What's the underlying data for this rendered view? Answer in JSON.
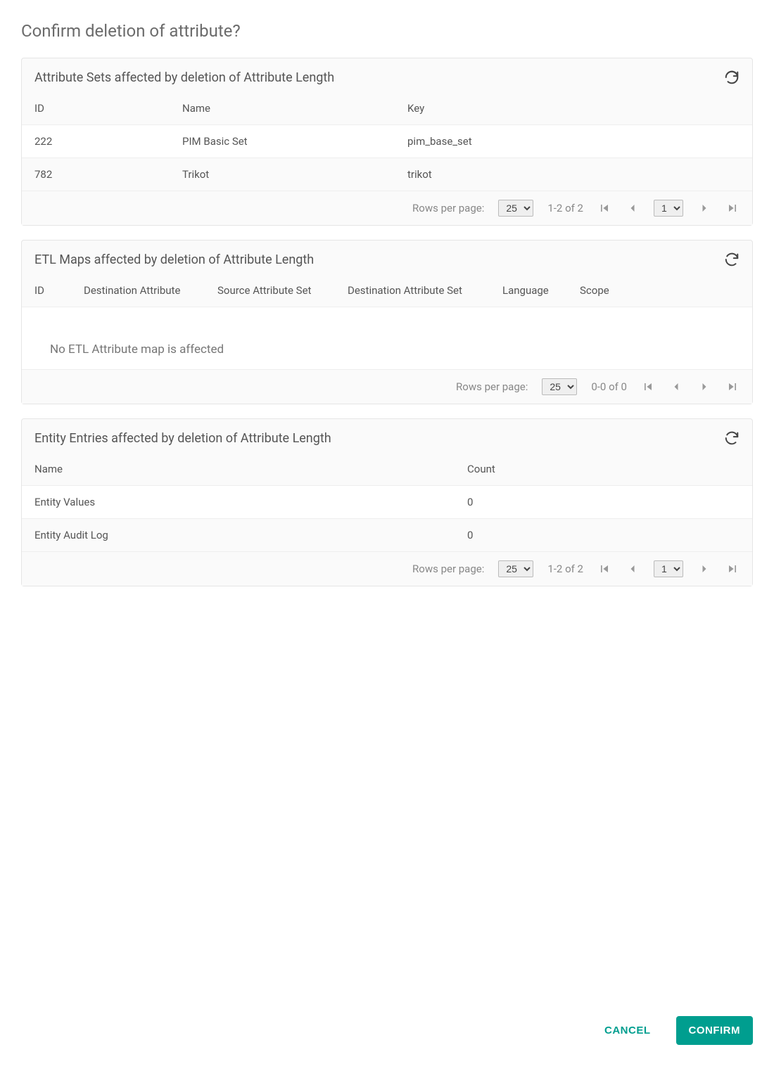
{
  "dialog": {
    "title": "Confirm deletion of attribute?",
    "cancel_label": "CANCEL",
    "confirm_label": "CONFIRM"
  },
  "pagination_labels": {
    "rows_per_page": "Rows per page:",
    "page_size_value": "25"
  },
  "card1": {
    "title": "Attribute Sets affected by deletion of Attribute Length",
    "headers": {
      "id": "ID",
      "name": "Name",
      "key": "Key"
    },
    "rows": [
      {
        "id": "222",
        "name": "PIM Basic Set",
        "key": "pim_base_set"
      },
      {
        "id": "782",
        "name": "Trikot",
        "key": "trikot"
      }
    ],
    "range": "1-2 of 2",
    "page_value": "1"
  },
  "card2": {
    "title": "ETL Maps affected by deletion of Attribute Length",
    "headers": {
      "id": "ID",
      "dest_attr": "Destination Attribute",
      "src_set": "Source Attribute Set",
      "dest_set": "Destination Attribute Set",
      "lang": "Language",
      "scope": "Scope"
    },
    "empty_message": "No ETL Attribute map is affected",
    "range": "0-0 of 0"
  },
  "card3": {
    "title": "Entity Entries affected by deletion of Attribute Length",
    "headers": {
      "name": "Name",
      "count": "Count"
    },
    "rows": [
      {
        "name": "Entity Values",
        "count": "0"
      },
      {
        "name": "Entity Audit Log",
        "count": "0"
      }
    ],
    "range": "1-2 of 2",
    "page_value": "1"
  }
}
